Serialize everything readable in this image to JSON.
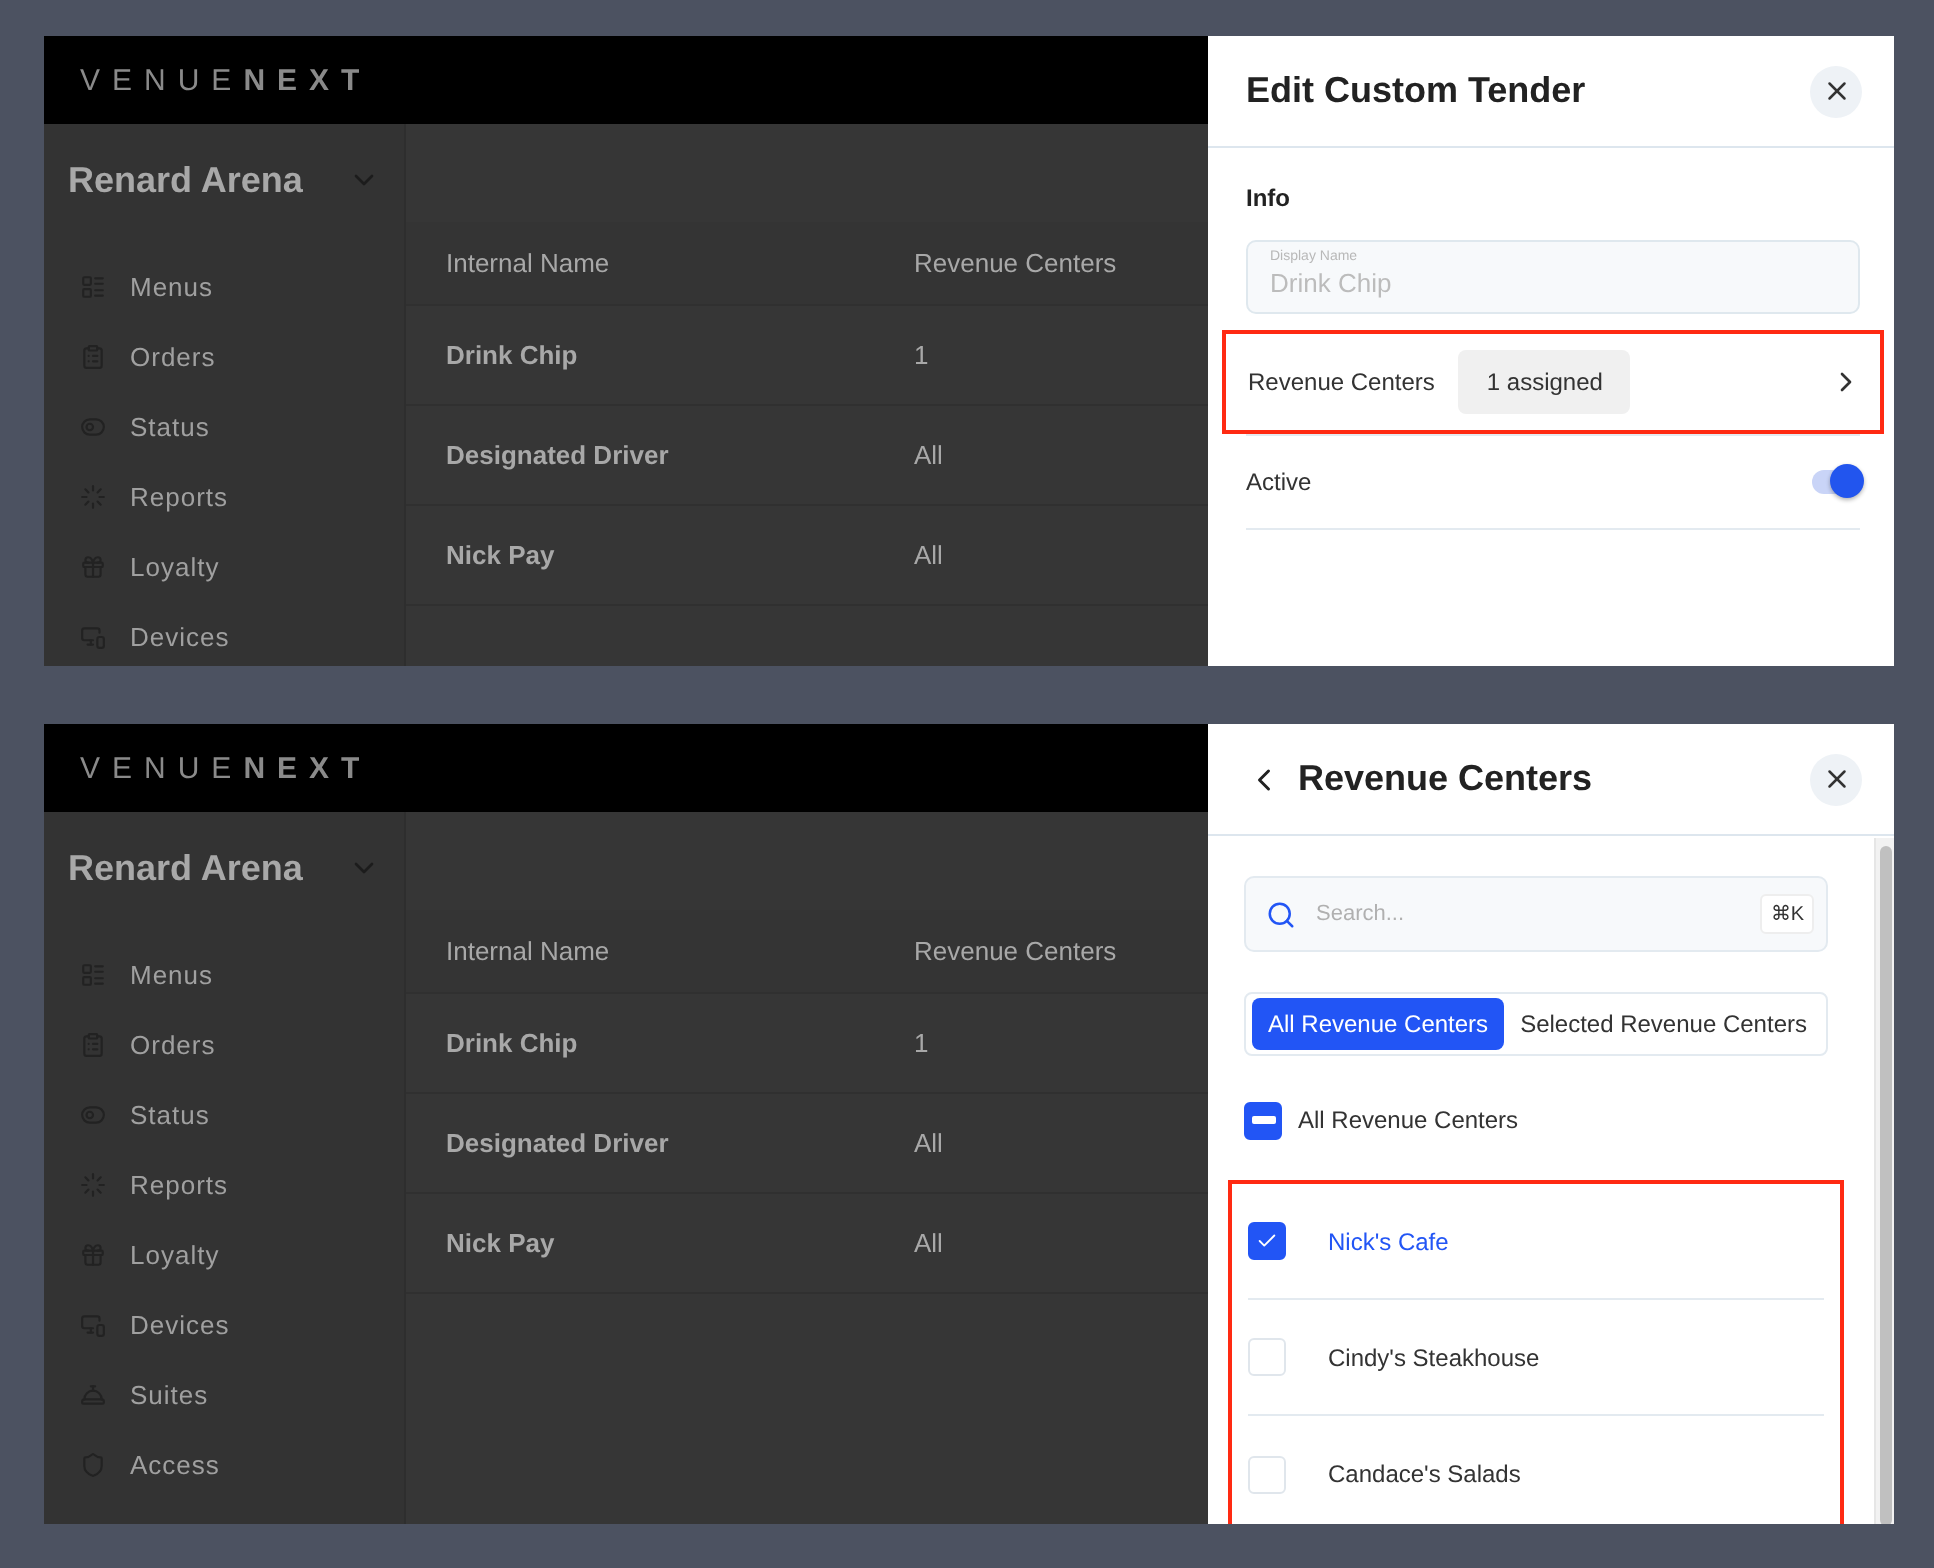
{
  "screens": [
    {
      "app": {
        "logo": {
          "light": "VENUE",
          "bold": "NEXT"
        },
        "venue": "Renard Arena",
        "nav": [
          "Menus",
          "Orders",
          "Status",
          "Reports",
          "Loyalty",
          "Devices"
        ],
        "table": {
          "columns": [
            "Internal Name",
            "Revenue Centers"
          ],
          "rows": [
            [
              "Drink Chip",
              "1"
            ],
            [
              "Designated Driver",
              "All"
            ],
            [
              "Nick Pay",
              "All"
            ]
          ]
        }
      },
      "drawer": {
        "kind": "edit",
        "title": "Edit Custom Tender",
        "section": "Info",
        "field": {
          "label": "Display Name",
          "value": "Drink Chip"
        },
        "link_row": {
          "label": "Revenue Centers",
          "badge": "1 assigned",
          "highlighted": true
        },
        "toggle_row": {
          "label": "Active",
          "on": true
        }
      }
    },
    {
      "app": {
        "logo": {
          "light": "VENUE",
          "bold": "NEXT"
        },
        "venue": "Renard Arena",
        "nav": [
          "Menus",
          "Orders",
          "Status",
          "Reports",
          "Loyalty",
          "Devices",
          "Suites",
          "Access"
        ],
        "table": {
          "columns": [
            "Internal Name",
            "Revenue Centers"
          ],
          "rows": [
            [
              "Drink Chip",
              "1"
            ],
            [
              "Designated Driver",
              "All"
            ],
            [
              "Nick Pay",
              "All"
            ]
          ]
        }
      },
      "drawer": {
        "kind": "list",
        "title": "Revenue Centers",
        "search": {
          "placeholder": "Search...",
          "shortcut": "⌘K"
        },
        "tabs": [
          {
            "label": "All Revenue Centers",
            "selected": true
          },
          {
            "label": "Selected Revenue Centers",
            "selected": false
          }
        ],
        "select_all": {
          "label": "All Revenue Centers",
          "indeterminate": true
        },
        "items_highlighted": true,
        "items": [
          {
            "label": "Nick's Cafe",
            "checked": true
          },
          {
            "label": "Cindy's Steakhouse",
            "checked": false
          },
          {
            "label": "Candace's Salads",
            "checked": false
          }
        ]
      }
    }
  ]
}
